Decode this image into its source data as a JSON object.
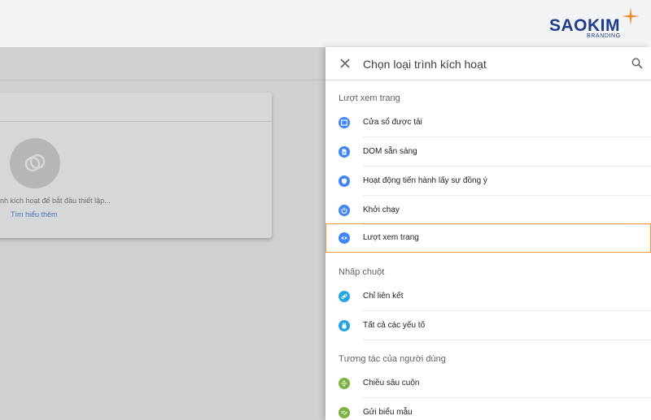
{
  "brand": {
    "name": "SAOKIM",
    "sub": "BRANDING",
    "accent_color": "#f28c28",
    "text_color": "#1f3d8a"
  },
  "background": {
    "card_text": "nh kích hoạt để bắt đầu thiết lập...",
    "learn_more": "Tìm hiểu thêm"
  },
  "panel": {
    "title": "Chọn loại trình kích hoạt",
    "close_icon": "close-icon",
    "search_icon": "search-icon",
    "sections": [
      {
        "heading": "Lượt xem trang",
        "items": [
          {
            "label": "Cửa sổ được tải",
            "icon": "window-icon",
            "color": "#4285f4"
          },
          {
            "label": "DOM sẵn sàng",
            "icon": "document-icon",
            "color": "#4285f4"
          },
          {
            "label": "Hoạt động tiến hành lấy sự đồng ý",
            "icon": "shield-icon",
            "color": "#4285f4"
          },
          {
            "label": "Khởi chạy",
            "icon": "power-icon",
            "color": "#4285f4"
          },
          {
            "label": "Lượt xem trang",
            "icon": "eye-icon",
            "color": "#4285f4",
            "selected": true
          }
        ]
      },
      {
        "heading": "Nhấp chuột",
        "items": [
          {
            "label": "Chỉ liên kết",
            "icon": "link-icon",
            "color": "#27a5e0"
          },
          {
            "label": "Tất cả các yếu tố",
            "icon": "cursor-icon",
            "color": "#27a5e0"
          }
        ]
      },
      {
        "heading": "Tương tác của người dùng",
        "items": [
          {
            "label": "Chiều sâu cuộn",
            "icon": "scroll-icon",
            "color": "#7cb342"
          },
          {
            "label": "Gửi biểu mẫu",
            "icon": "form-icon",
            "color": "#7cb342"
          }
        ]
      }
    ],
    "selected_border_color": "#f29b38"
  }
}
